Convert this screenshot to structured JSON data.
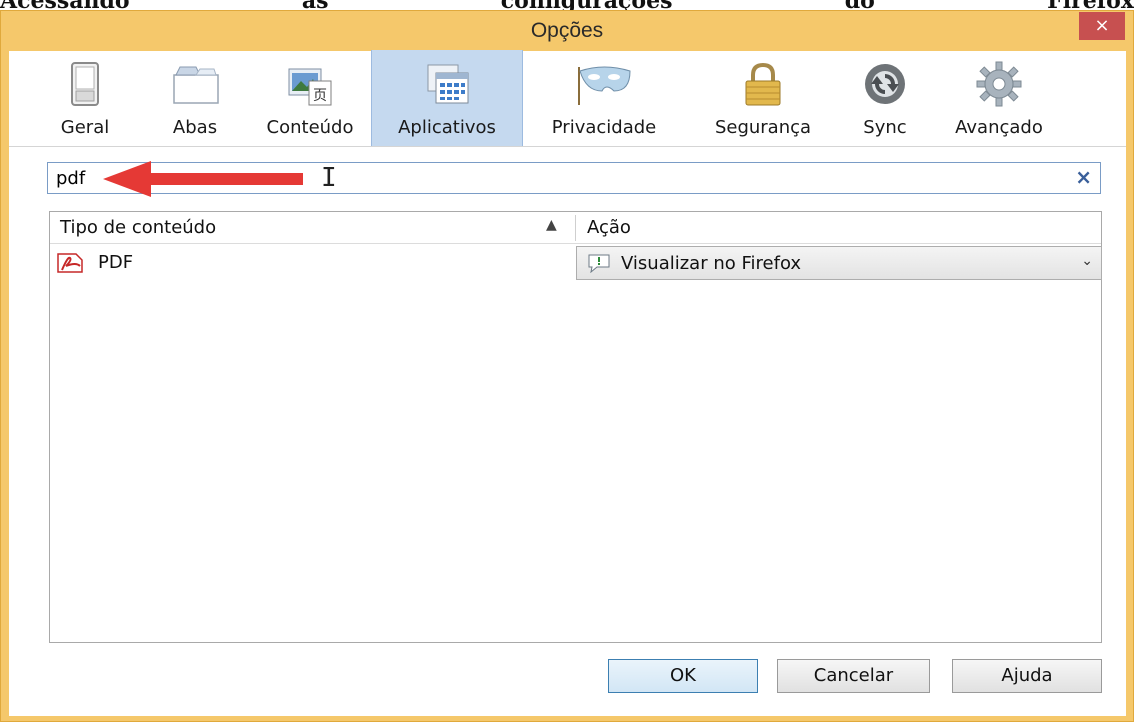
{
  "doc_heading": {
    "words": [
      "Acessando",
      "as",
      "configurações",
      "do",
      "Firefox"
    ]
  },
  "window": {
    "title": "Opções",
    "close_symbol": "×"
  },
  "toolbar": {
    "tabs": [
      {
        "label": "Geral",
        "icon": "switch-icon"
      },
      {
        "label": "Abas",
        "icon": "tabs-icon"
      },
      {
        "label": "Conteúdo",
        "icon": "content-icon"
      },
      {
        "label": "Aplicativos",
        "icon": "applications-icon",
        "active": true
      },
      {
        "label": "Privacidade",
        "icon": "mask-icon"
      },
      {
        "label": "Segurança",
        "icon": "padlock-icon"
      },
      {
        "label": "Sync",
        "icon": "sync-icon"
      },
      {
        "label": "Avançado",
        "icon": "gear-icon"
      }
    ]
  },
  "search": {
    "value": "pdf",
    "clear_symbol": "×"
  },
  "table": {
    "columns": [
      "Tipo de conteúdo",
      "Ação"
    ],
    "sort_symbol": "▲",
    "rows": [
      {
        "type": "PDF",
        "action": "Visualizar no Firefox"
      }
    ],
    "dropdown_symbol": "⌄"
  },
  "buttons": {
    "ok": "OK",
    "cancel": "Cancelar",
    "help": "Ajuda"
  },
  "colors": {
    "window_frame": "#f5c86b",
    "close_button": "#c75050",
    "active_tab": "#c5d9ef",
    "arrow": "#e53935"
  }
}
